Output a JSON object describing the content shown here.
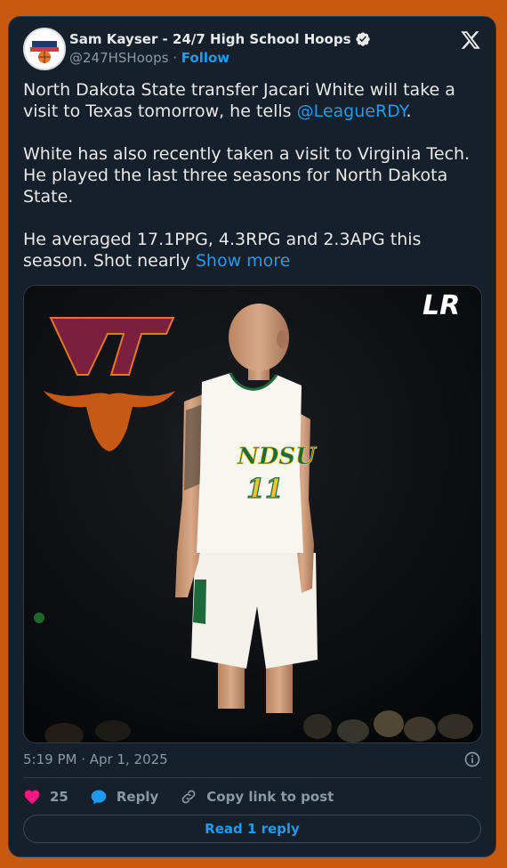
{
  "author": {
    "name": "Sam Kayser - 24/7 High School Hoops",
    "handle": "@247HSHoops",
    "separator": "·",
    "follow_label": "Follow"
  },
  "tweet": {
    "p1_text": "North Dakota State transfer Jacari White will take a visit to Texas tomorrow, he tells ",
    "p1_mention": "@LeagueRDY",
    "p1_end": ".",
    "p2_text": "White has also recently taken a visit to Virginia Tech. He played the last three seasons for North Dakota State.",
    "p3_text": "He averaged 17.1PPG, 4.3RPG and 2.3APG this season. Shot nearly ",
    "show_more": "Show more"
  },
  "media": {
    "jersey_team": "NDSU",
    "jersey_number": "11",
    "watermark": "LR",
    "logo_left": "VT"
  },
  "meta": {
    "timestamp": "5:19 PM · Apr 1, 2025"
  },
  "actions": {
    "like_count": "25",
    "reply_label": "Reply",
    "copy_label": "Copy link to post"
  },
  "read_reply_label": "Read 1 reply",
  "colors": {
    "background": "#c75a0c",
    "card": "#15202b",
    "accent": "#1d9bf0",
    "like": "#f91880",
    "muted": "#8b98a5"
  }
}
